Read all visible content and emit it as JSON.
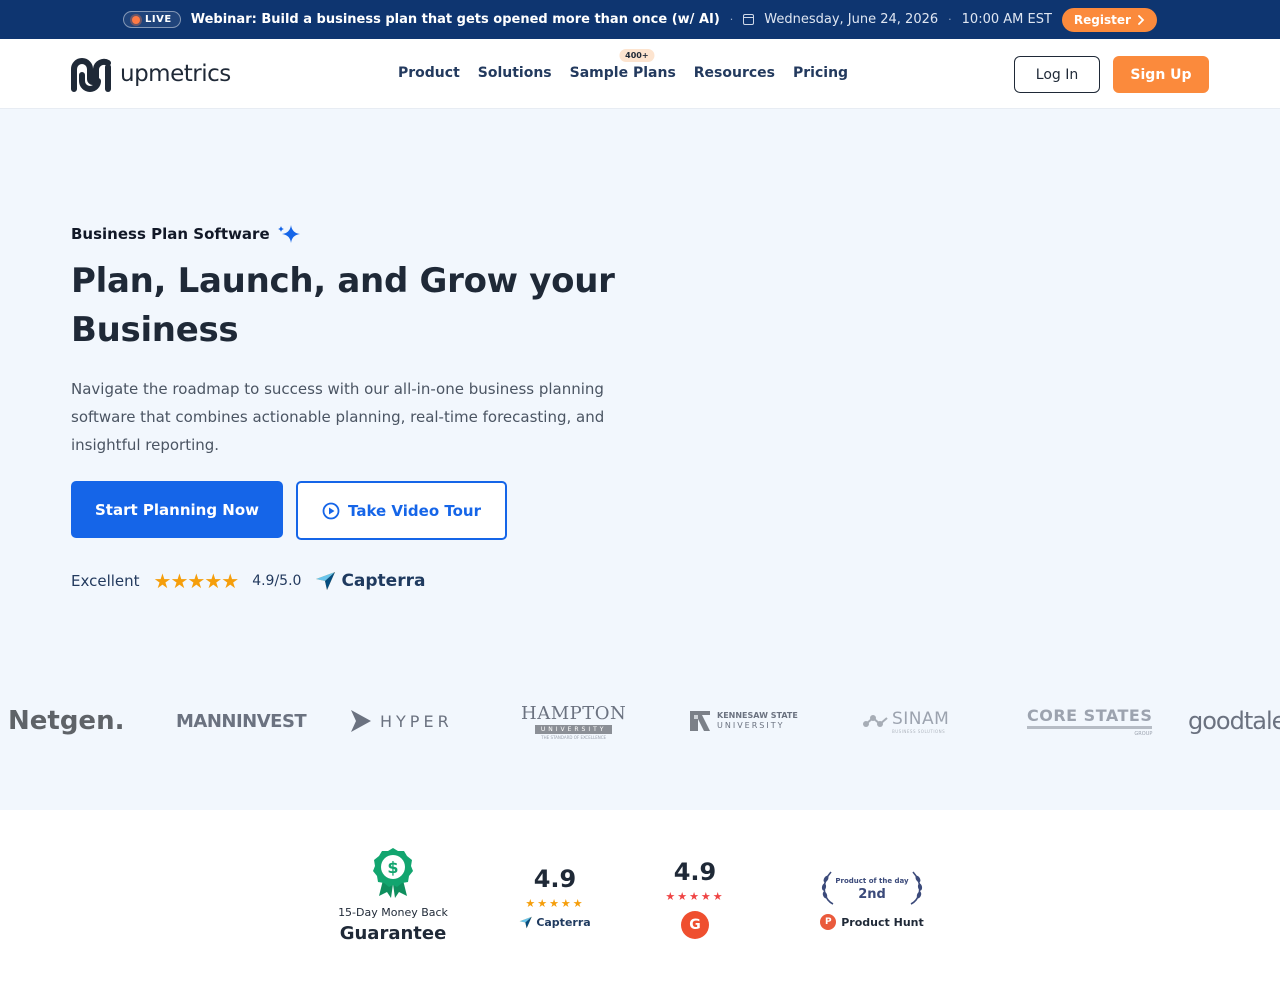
{
  "banner": {
    "live_label": "LIVE",
    "title": "Webinar: Build a business plan that gets opened more than once (w/ AI)",
    "date": "Wednesday, June 24, 2026",
    "separator": "·",
    "time": "10:00 AM EST",
    "register_label": "Register"
  },
  "header": {
    "logo_text": "upmetrics",
    "nav": [
      {
        "label": "Product"
      },
      {
        "label": "Solutions"
      },
      {
        "label": "Sample Plans",
        "badge": "400+"
      },
      {
        "label": "Resources"
      },
      {
        "label": "Pricing"
      }
    ],
    "login_label": "Log In",
    "signup_label": "Sign Up"
  },
  "hero": {
    "eyebrow": "Business Plan Software",
    "title": "Plan, Launch, and Grow your Business",
    "description": "Navigate the roadmap to success with our all-in-one business planning software that combines actionable planning, real-time forecasting, and insightful reporting.",
    "cta_primary": "Start Planning Now",
    "cta_secondary": "Take Video Tour",
    "rating_label": "Excellent",
    "stars": "★★★★★",
    "rating_score": "4.9/5.0",
    "rating_source": "Capterra"
  },
  "logos": {
    "netgen": "Netgen.",
    "manninvest": "MANNINVEST",
    "hyper": "HYPER",
    "hampton": {
      "main": "HAMPTON",
      "bar": "UNIVERSITY",
      "sub": "THE STANDARD OF EXCELLENCE"
    },
    "kennesaw": {
      "line1": "KENNESAW STATE",
      "line2": "UNIVERSITY"
    },
    "sinam": {
      "main": "SINAM",
      "sub": "BUSINESS SOLUTIONS"
    },
    "core_states": {
      "main": "CORE STATES",
      "sub": "GROUP"
    },
    "goodtalent": "goodtale"
  },
  "trust": {
    "money_caption": "15-Day Money Back",
    "money_main": "Guarantee",
    "capterra_score": "4.9",
    "capterra_stars": "★★★★★",
    "capterra_name": "Capterra",
    "g2_score": "4.9",
    "g2_stars": "★★★★★",
    "g2_logo": "G",
    "ph_caption": "Product of the day",
    "ph_rank": "2nd",
    "ph_logo": "P",
    "ph_name": "Product Hunt"
  },
  "colors": {
    "banner_bg": "#0e3570",
    "accent_orange": "#fb8a3c",
    "primary_blue": "#1565e8",
    "hero_bg": "#f2f7fd",
    "star_gold": "#f59e0b",
    "g2_red": "#ef4f2f"
  },
  "icons": [
    "calendar-icon",
    "chevron-right-icon",
    "sparkle-icon",
    "play-circle-icon",
    "capterra-arrow-icon",
    "money-badge-icon",
    "laurel-icon",
    "g2-logo",
    "product-hunt-logo",
    "upmetrics-logo"
  ]
}
